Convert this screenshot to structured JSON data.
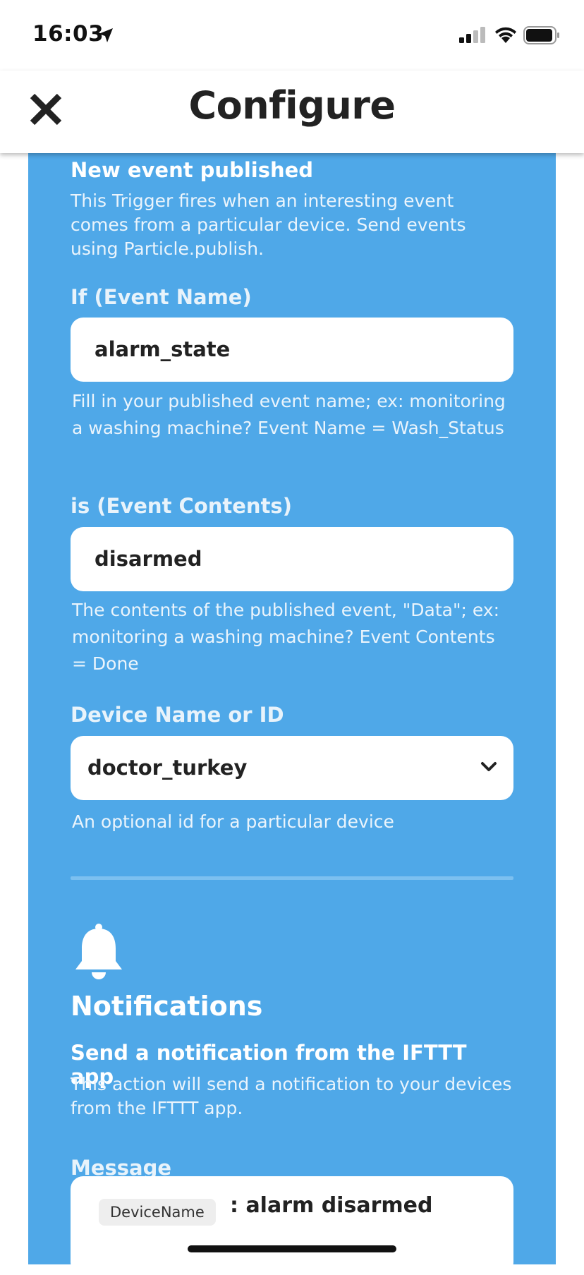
{
  "status_bar": {
    "time": "16:03",
    "icons": [
      "location-arrow-icon",
      "cellular-signal-icon",
      "wifi-icon",
      "battery-icon"
    ]
  },
  "header": {
    "title": "Configure",
    "close_icon": "close-icon"
  },
  "trigger": {
    "title": "New event published",
    "description": "This Trigger fires when an interesting event comes from a particular device. Send events using Particle.publish.",
    "fields": {
      "event_name": {
        "label": "If (Event Name)",
        "value": "alarm_state",
        "help": "Fill in your published event name; ex: monitoring a washing machine? Event Name = Wash_Status"
      },
      "event_contents": {
        "label": "is (Event Contents)",
        "value": "disarmed",
        "help": "The contents of the published event, \"Data\"; ex: monitoring a washing machine? Event Contents = Done"
      },
      "device": {
        "label": "Device Name or ID",
        "value": "doctor_turkey",
        "help": "An optional id for a particular device"
      }
    }
  },
  "action": {
    "service_title": "Notifications",
    "service_icon": "bell-icon",
    "title": "Send a notification from the IFTTT app",
    "description": "This action will send a notification to your devices from the IFTTT app.",
    "message": {
      "label": "Message",
      "ingredient": "DeviceName",
      "text": ": alarm disarmed"
    }
  },
  "colors": {
    "panel": "#4fa8e8",
    "divider": "#7cc0f0",
    "text_dark": "#222222"
  }
}
